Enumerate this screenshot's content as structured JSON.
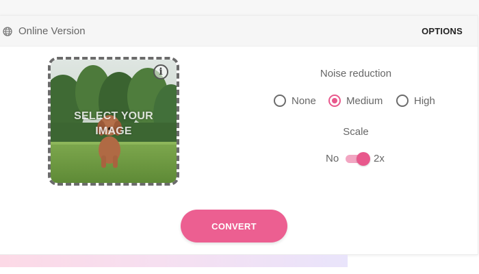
{
  "header": {
    "version_label": "Online Version",
    "globe_icon": "globe-icon",
    "options_label": "OPTIONS"
  },
  "upload": {
    "overlay_line1": "SELECT YOUR",
    "overlay_line2": "IMAGE",
    "info_icon": "info-icon",
    "info_glyph": "i"
  },
  "noise_reduction": {
    "title": "Noise reduction",
    "options": [
      {
        "label": "None",
        "checked": false
      },
      {
        "label": "Medium",
        "checked": true
      },
      {
        "label": "High",
        "checked": false
      }
    ]
  },
  "scale": {
    "title": "Scale",
    "off_label": "No",
    "on_label": "2x",
    "enabled": true
  },
  "convert_label": "CONVERT",
  "colors": {
    "accent": "#ec5f91",
    "accent_light": "#f2a6c2",
    "header_bg": "#f6f6f6"
  }
}
